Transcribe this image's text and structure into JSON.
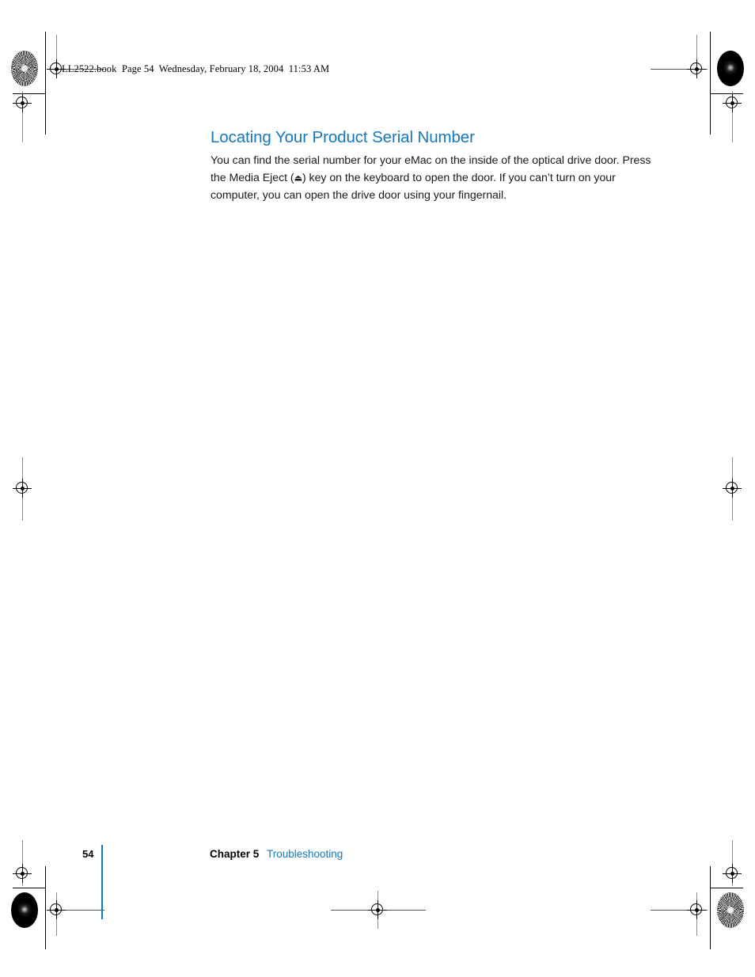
{
  "document": {
    "book_header": "LL2522.book  Page 54  Wednesday, February 18, 2004  11:53 AM",
    "section_title": "Locating Your Product Serial Number",
    "body_line_1": "You can find the serial number for your eMac on the inside of the optical drive door.",
    "body_line_2_before_glyph": "Press the Media Eject (",
    "eject_glyph": "⏏",
    "body_line_2_after_glyph": ") key on the keyboard to open the door. If you can’t turn on",
    "body_line_3": "your computer, you can open the drive door using your fingernail."
  },
  "footer": {
    "page_number": "54",
    "chapter_label": "Chapter 5",
    "chapter_title": "Troubleshooting"
  },
  "colors": {
    "accent_blue": "#1378bc",
    "body_text": "#1a1a1a",
    "mark_black": "#000000"
  },
  "print_marks": {
    "registration_mark_count": 8,
    "halftone_patch_count": 4,
    "trim_line_color": "#000000"
  }
}
